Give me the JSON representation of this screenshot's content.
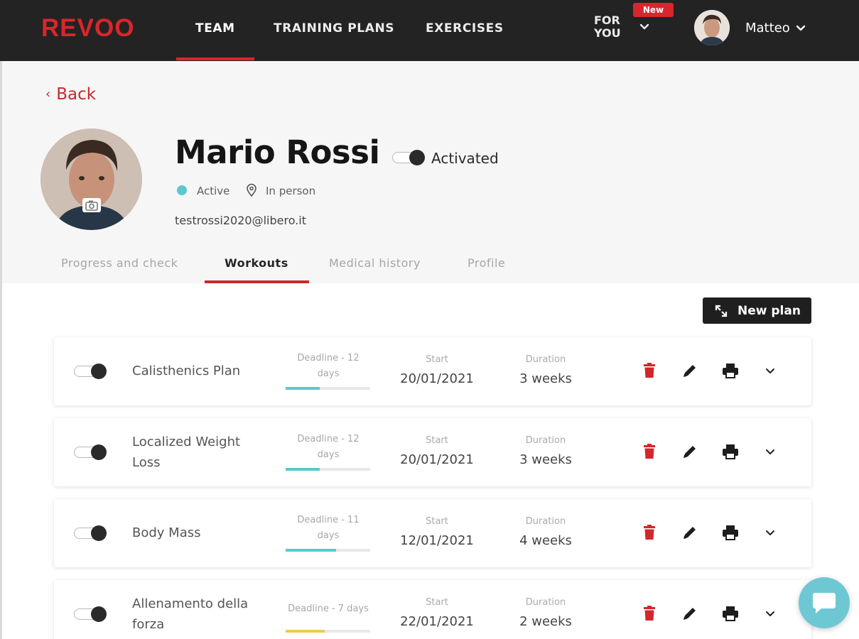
{
  "brand": {
    "logo": "REVOO",
    "accent": "#d9262c"
  },
  "nav": {
    "team": "TEAM",
    "training_plans": "TRAINING PLANS",
    "exercises": "EXERCISES",
    "for_you_line1": "FOR",
    "for_you_line2": "YOU",
    "new_badge": "New",
    "user_name": "Matteo"
  },
  "back_label": "Back",
  "profile": {
    "name": "Mario Rossi",
    "activation_label": "Activated",
    "status": "Active",
    "status_color": "#5ac9cd",
    "location": "In person",
    "email": "testrossi2020@libero.it"
  },
  "tabs": [
    {
      "label": "Progress and check",
      "active": false
    },
    {
      "label": "Workouts",
      "active": true
    },
    {
      "label": "Medical history",
      "active": false
    },
    {
      "label": "Profile",
      "active": false
    }
  ],
  "new_plan_label": "New plan",
  "plans_columns": {
    "start": "Start",
    "duration": "Duration"
  },
  "plans": [
    {
      "name_line1": "Calisthenics Plan",
      "name_line2": "",
      "deadline_line1": "Deadline - 12",
      "deadline_line2": "days",
      "progress": 0.4,
      "progress_color": "#5ac9cd",
      "start": "20/01/2021",
      "duration": "3 weeks"
    },
    {
      "name_line1": "Localized Weight",
      "name_line2": "Loss",
      "deadline_line1": "Deadline - 12",
      "deadline_line2": "days",
      "progress": 0.4,
      "progress_color": "#5ac9cd",
      "start": "20/01/2021",
      "duration": "3 weeks"
    },
    {
      "name_line1": "Body Mass",
      "name_line2": "",
      "deadline_line1": "Deadline - 11",
      "deadline_line2": "days",
      "progress": 0.6,
      "progress_color": "#5ac9cd",
      "start": "12/01/2021",
      "duration": "4 weeks"
    },
    {
      "name_line1": "Allenamento della",
      "name_line2": "forza",
      "deadline_line1": "Deadline - 7 days",
      "deadline_line2": "",
      "progress": 0.46,
      "progress_color": "#f2c94c",
      "start": "22/01/2021",
      "duration": "2 weeks"
    }
  ],
  "icons": {
    "delete": "trash-icon",
    "edit": "pencil-icon",
    "print": "printer-icon",
    "expand": "chevron-down-icon",
    "chat": "chat-icon"
  }
}
